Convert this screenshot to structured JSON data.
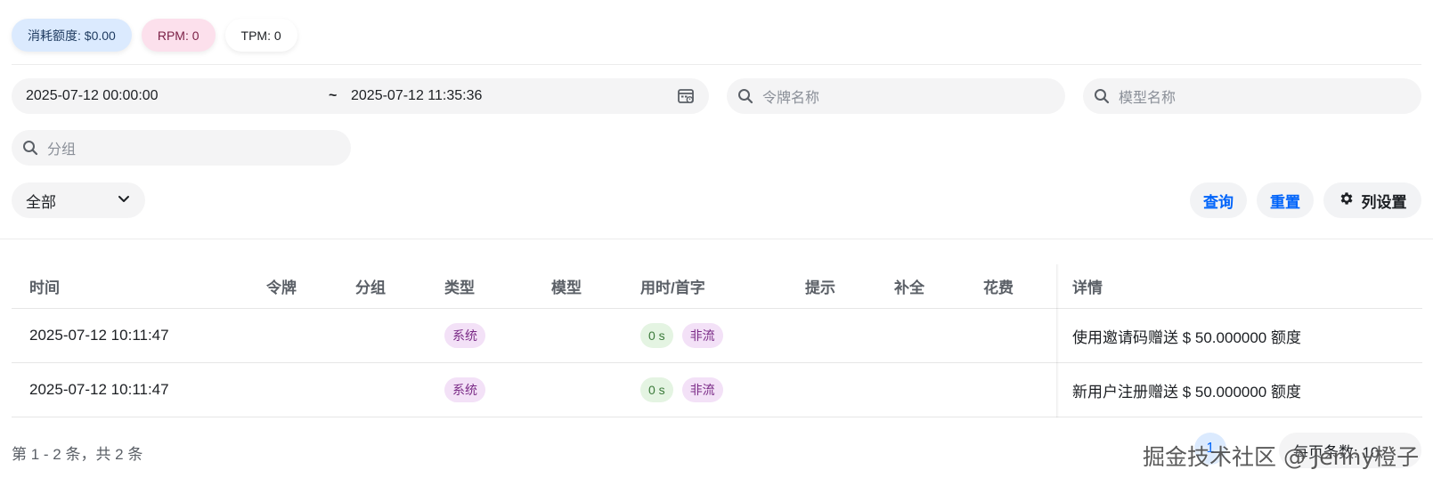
{
  "stats": {
    "quota": "消耗额度: $0.00",
    "rpm": "RPM: 0",
    "tpm": "TPM: 0"
  },
  "filters": {
    "start_time": "2025-07-12 00:00:00",
    "separator": "~",
    "end_time": "2025-07-12 11:35:36",
    "token_placeholder": "令牌名称",
    "model_placeholder": "模型名称",
    "group_placeholder": "分组",
    "type_select": "全部"
  },
  "actions": {
    "query": "查询",
    "reset": "重置",
    "columns": "列设置"
  },
  "table": {
    "headers": {
      "time": "时间",
      "token": "令牌",
      "group": "分组",
      "type": "类型",
      "model": "模型",
      "duration": "用时/首字",
      "prompt": "提示",
      "completion": "补全",
      "cost": "花费",
      "detail": "详情"
    },
    "rows": [
      {
        "time": "2025-07-12 10:11:47",
        "type": "系统",
        "duration": "0 s",
        "stream": "非流",
        "detail": "使用邀请码赠送 $ 50.000000 额度"
      },
      {
        "time": "2025-07-12 10:11:47",
        "type": "系统",
        "duration": "0 s",
        "stream": "非流",
        "detail": "新用户注册赠送 $ 50.000000 额度"
      }
    ]
  },
  "pagination": {
    "info": "第 1 - 2 条，共 2 条",
    "current_page": "1",
    "page_size_label": "每页条数: 10"
  },
  "watermark": "掘金技术社区 @ Jenny橙子",
  "colors": {
    "accent": "#0064fa",
    "quota_bg": "#dbeafe",
    "rpm_bg": "#fce0ec",
    "tag_purple_bg": "#f3e1f7",
    "tag_green_bg": "#e4f4e2"
  }
}
